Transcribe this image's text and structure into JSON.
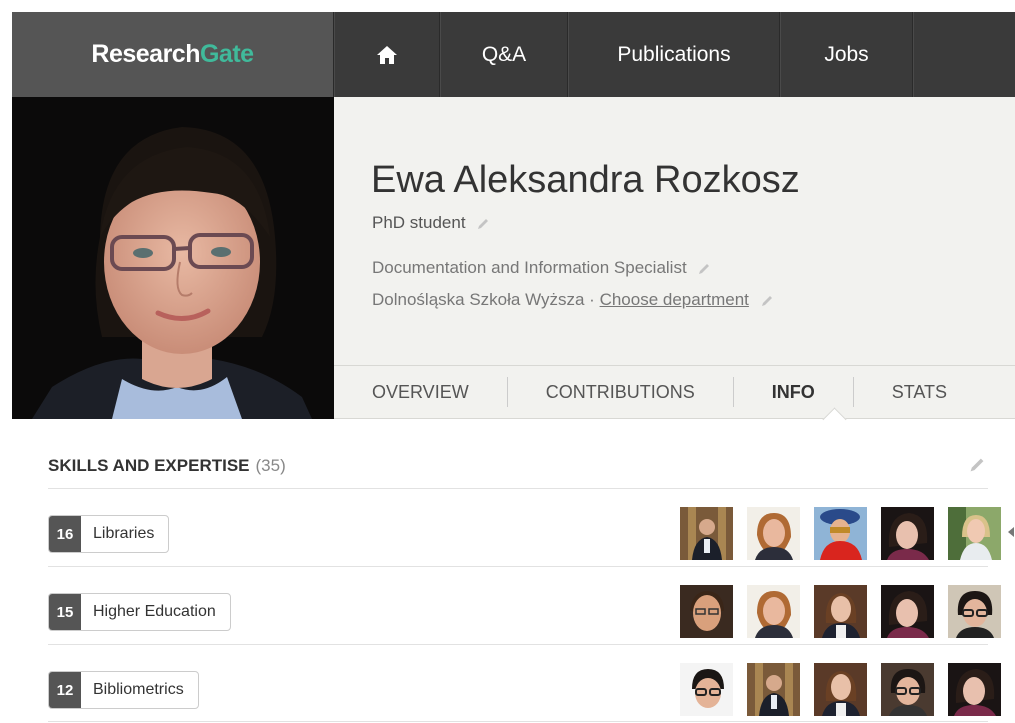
{
  "brand": {
    "part1": "Research",
    "part2": "Gate",
    "accent": "#40ba9b"
  },
  "nav": {
    "items": [
      {
        "icon": "home-icon"
      },
      {
        "label": "Q&A"
      },
      {
        "label": "Publications"
      },
      {
        "label": "Jobs"
      }
    ]
  },
  "profile": {
    "name": "Ewa Aleksandra Rozkosz",
    "role": "PhD student",
    "position": "Documentation and Information Specialist",
    "institution": "Dolnośląska Szkoła Wyższa",
    "separator": "·",
    "department_link": "Choose department"
  },
  "tabs": [
    "OVERVIEW",
    "CONTRIBUTIONS",
    "INFO",
    "STATS"
  ],
  "active_tab": "INFO",
  "skills": {
    "heading": "SKILLS AND EXPERTISE",
    "count": "(35)",
    "items": [
      {
        "count": "16",
        "label": "Libraries"
      },
      {
        "count": "15",
        "label": "Higher Education"
      },
      {
        "count": "12",
        "label": "Bibliometrics"
      }
    ]
  }
}
